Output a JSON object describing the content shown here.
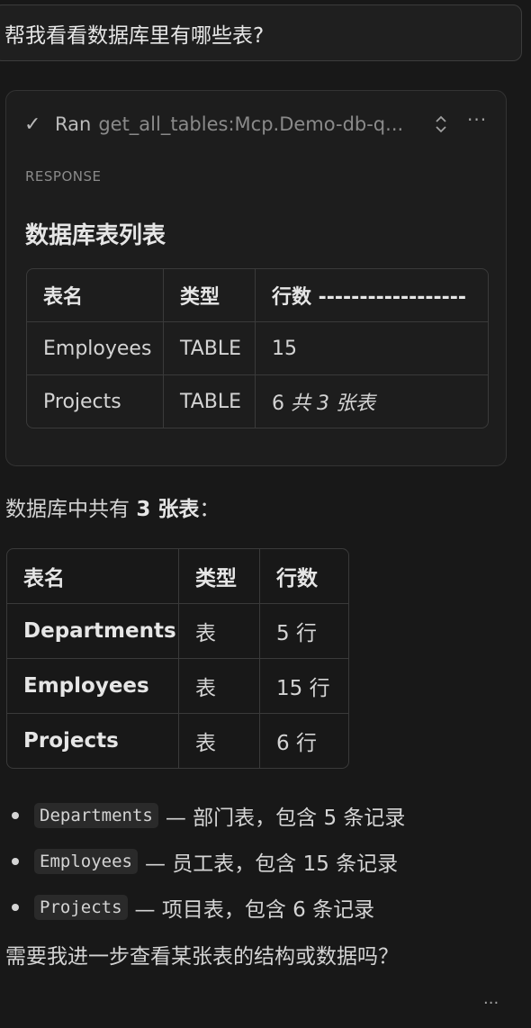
{
  "prompt": {
    "text": "帮我看看数据库里有哪些表?"
  },
  "tool_call": {
    "status_icon": "check-icon",
    "ran_label": "Ran",
    "tool_name": "get_all_tables:Mcp.Demo-db-q...",
    "response_label": "RESPONSE",
    "response_title": "数据库表列表",
    "table": {
      "headers": [
        "表名",
        "类型",
        "行数 ------------------"
      ],
      "rows": [
        {
          "name": "Employees",
          "type": "TABLE",
          "count": "15",
          "note": ""
        },
        {
          "name": "Projects",
          "type": "TABLE",
          "count": "6",
          "note": "共 3 张表"
        }
      ]
    }
  },
  "answer": {
    "intro_prefix": "数据库中共有 ",
    "intro_bold": "3 张表",
    "intro_suffix": "：",
    "table": {
      "headers": [
        "表名",
        "类型",
        "行数"
      ],
      "rows": [
        {
          "name": "Departments",
          "type": "表",
          "count": "5 行"
        },
        {
          "name": "Employees",
          "type": "表",
          "count": "15 行"
        },
        {
          "name": "Projects",
          "type": "表",
          "count": "6 行"
        }
      ]
    },
    "bullets": [
      {
        "code": "Departments",
        "text": "— 部门表，包含 5 条记录"
      },
      {
        "code": "Employees",
        "text": "— 员工表，包含 15 条记录"
      },
      {
        "code": "Projects",
        "text": "— 项目表，包含 6 条记录"
      }
    ],
    "followup": "需要我进一步查看某张表的结构或数据吗？"
  },
  "more_actions": "···"
}
